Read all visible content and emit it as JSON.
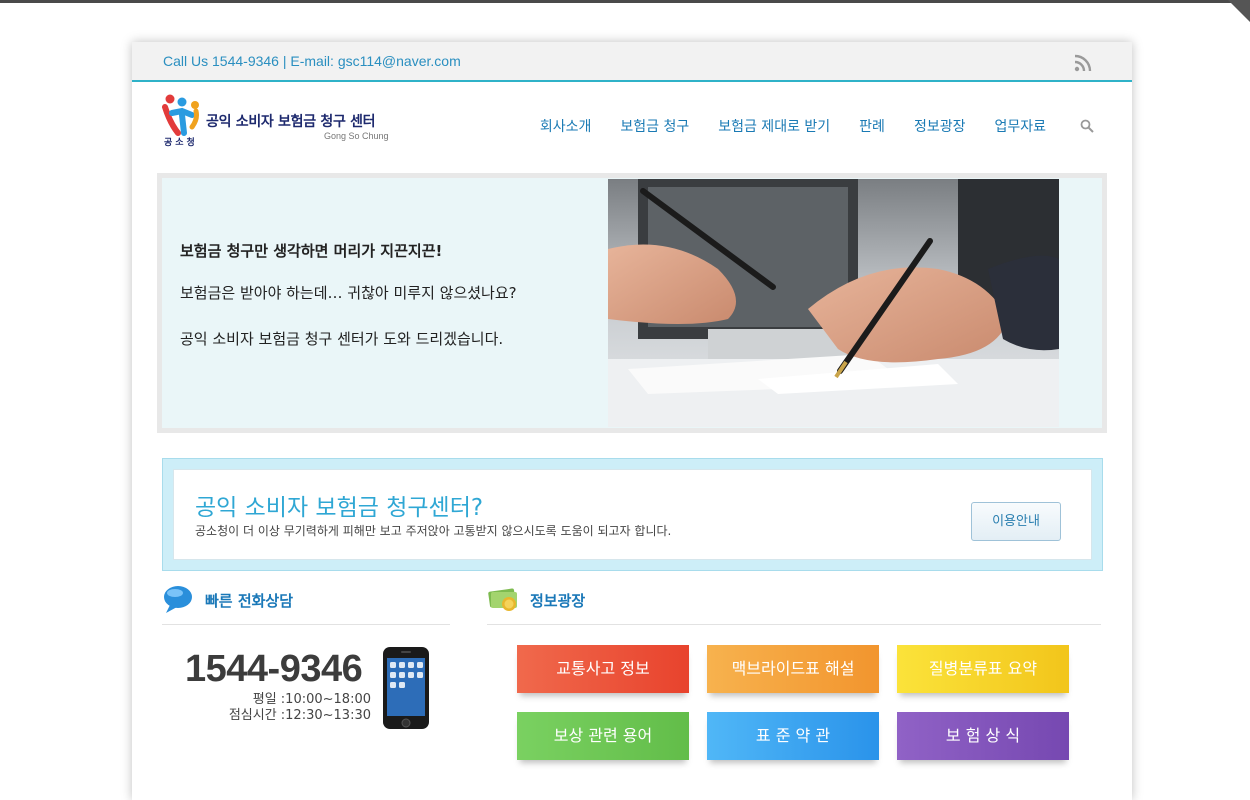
{
  "topbar": {
    "contact": "Call Us 1544-9346 | E-mail: gsc114@naver.com"
  },
  "logo": {
    "name": "공익 소비자 보험금 청구 센터",
    "english": "Gong So Chung",
    "sub": "공소청"
  },
  "nav": {
    "items": [
      "회사소개",
      "보험금 청구",
      "보험금 제대로 받기",
      "판례",
      "정보광장",
      "업무자료"
    ]
  },
  "hero": {
    "line1": "보험금 청구만 생각하면 머리가 지끈지끈!",
    "line2": "보험금은 받아야 하는데… 귀찮아 미루지 않으셨나요?",
    "line3": "공익 소비자 보험금 청구 센터가 도와 드리겠습니다."
  },
  "intro": {
    "title": "공익 소비자 보험금 청구센터?",
    "desc": "공소청이 더 이상 무기력하게 피해만 보고 주저앉아 고통받지 않으시도록 도움이 되고자 합니다.",
    "button": "이용안내"
  },
  "consult": {
    "title": "빠른 전화상담",
    "phone": "1544-9346",
    "weekday": "평일 :10:00~18:00",
    "lunch": "점심시간 :12:30~13:30"
  },
  "info": {
    "title": "정보광장",
    "tiles": [
      "교통사고 정보",
      "맥브라이드표 해설",
      "질병분류표 요약",
      "보상 관련 용어",
      "표 준 약 관",
      "보 험 상 식"
    ]
  },
  "colors": {
    "accent": "#2fb2c8",
    "nav": "#1a7ab4",
    "tile_red": "#e8432d",
    "tile_orange": "#f2952e",
    "tile_yellow": "#f2c51b",
    "tile_green": "#62bd49",
    "tile_blue": "#2a93ea",
    "tile_purple": "#7648b1"
  }
}
